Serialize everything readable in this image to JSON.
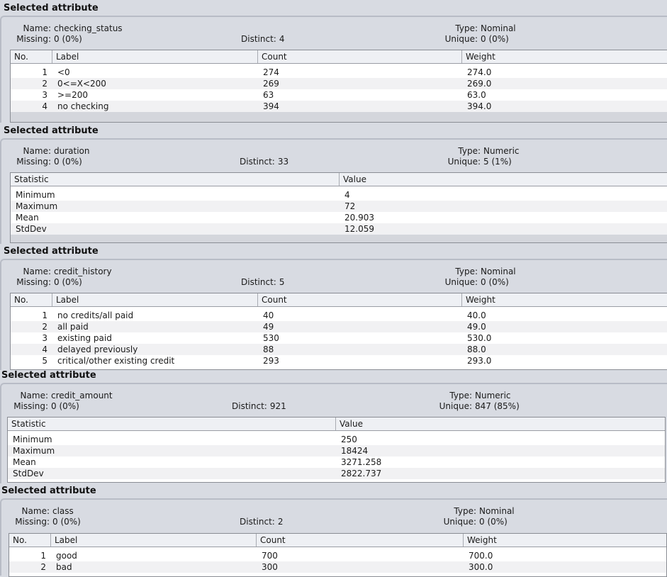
{
  "panel_title": "Selected attribute",
  "labels": {
    "name": "Name:",
    "missing": "Missing:",
    "distinct": "Distinct:",
    "type": "Type:",
    "unique": "Unique:"
  },
  "nominal_headers": [
    "No.",
    "Label",
    "Count",
    "Weight"
  ],
  "numeric_headers": [
    "Statistic",
    "Value"
  ],
  "attributes": [
    {
      "name": "checking_status",
      "missing": "0 (0%)",
      "distinct": "4",
      "type": "Nominal",
      "unique": "0 (0%)",
      "rows": [
        [
          "1",
          "<0",
          "274",
          "274.0"
        ],
        [
          "2",
          "0<=X<200",
          "269",
          "269.0"
        ],
        [
          "3",
          ">=200",
          "63",
          "63.0"
        ],
        [
          "4",
          "no checking",
          "394",
          "394.0"
        ]
      ]
    },
    {
      "name": "duration",
      "missing": "0 (0%)",
      "distinct": "33",
      "type": "Numeric",
      "unique": "5 (1%)",
      "rows": [
        [
          "Minimum",
          "4"
        ],
        [
          "Maximum",
          "72"
        ],
        [
          "Mean",
          "20.903"
        ],
        [
          "StdDev",
          "12.059"
        ]
      ]
    },
    {
      "name": "credit_history",
      "missing": "0 (0%)",
      "distinct": "5",
      "type": "Nominal",
      "unique": "0 (0%)",
      "rows": [
        [
          "1",
          "no credits/all paid",
          "40",
          "40.0"
        ],
        [
          "2",
          "all paid",
          "49",
          "49.0"
        ],
        [
          "3",
          "existing paid",
          "530",
          "530.0"
        ],
        [
          "4",
          "delayed previously",
          "88",
          "88.0"
        ],
        [
          "5",
          "critical/other existing credit",
          "293",
          "293.0"
        ]
      ]
    },
    {
      "name": "credit_amount",
      "missing": "0 (0%)",
      "distinct": "921",
      "type": "Numeric",
      "unique": "847 (85%)",
      "rows": [
        [
          "Minimum",
          "250"
        ],
        [
          "Maximum",
          "18424"
        ],
        [
          "Mean",
          "3271.258"
        ],
        [
          "StdDev",
          "2822.737"
        ]
      ]
    },
    {
      "name": "class",
      "missing": "0 (0%)",
      "distinct": "2",
      "type": "Nominal",
      "unique": "0 (0%)",
      "rows": [
        [
          "1",
          "good",
          "700",
          "700.0"
        ],
        [
          "2",
          "bad",
          "300",
          "300.0"
        ]
      ]
    }
  ]
}
